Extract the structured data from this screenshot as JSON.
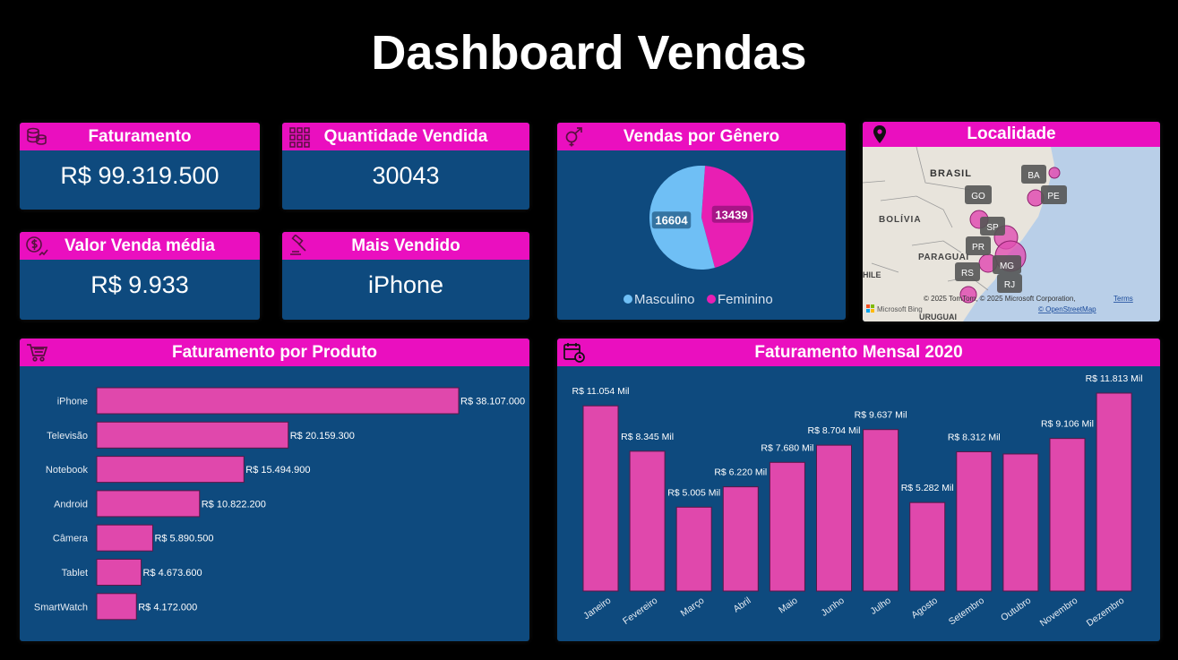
{
  "dashboard": {
    "title": "Dashboard Vendas"
  },
  "kpis": {
    "faturamento": {
      "label": "Faturamento",
      "value": "R$ 99.319.500"
    },
    "quantidade": {
      "label": "Quantidade Vendida",
      "value": "30043"
    },
    "ticket_medio": {
      "label": "Valor Venda média",
      "value": "R$ 9.933"
    },
    "mais_vendido": {
      "label": "Mais Vendido",
      "value": "iPhone"
    }
  },
  "colors": {
    "header": "#ea0fbf",
    "card": "#0e4a7e",
    "bar": "#e048ac",
    "masculino": "#6fbff5",
    "feminino": "#e81fb3"
  },
  "map": {
    "title": "Localidade",
    "country_labels": [
      "BRASIL",
      "BOLÍVIA",
      "PARAGUAI",
      "URUGUAI",
      "HILE"
    ],
    "state_labels": [
      "BA",
      "PE",
      "GO",
      "SP",
      "PR",
      "MG",
      "RS",
      "RJ"
    ],
    "attribution": "© 2025 TomTom, © 2025 Microsoft Corporation,",
    "terms": "Terms",
    "osm": "© OpenStreetMap",
    "bing": "Microsoft Bing"
  },
  "chart_data": [
    {
      "type": "pie",
      "title": "Vendas por Gênero",
      "labels": [
        "Masculino",
        "Feminino"
      ],
      "values": [
        16604,
        13439
      ],
      "colors": [
        "#6fbff5",
        "#e81fb3"
      ],
      "legend": "bottom"
    },
    {
      "type": "bar",
      "orientation": "horizontal",
      "title": "Faturamento por Produto",
      "categories": [
        "iPhone",
        "Televisão",
        "Notebook",
        "Android",
        "Câmera",
        "Tablet",
        "SmartWatch"
      ],
      "values": [
        38107000,
        20159300,
        15494900,
        10822200,
        5890500,
        4673600,
        4172000
      ],
      "data_labels": [
        "R$ 38.107.000",
        "R$ 20.159.300",
        "R$ 15.494.900",
        "R$ 10.822.200",
        "R$ 5.890.500",
        "R$ 4.673.600",
        "R$ 4.172.000"
      ]
    },
    {
      "type": "bar",
      "title": "Faturamento Mensal 2020",
      "categories": [
        "Janeiro",
        "Fevereiro",
        "Março",
        "Abril",
        "Maio",
        "Junho",
        "Julho",
        "Agosto",
        "Setembro",
        "Outubro",
        "Novembro",
        "Dezembro"
      ],
      "values": [
        11054,
        8345,
        5005,
        6220,
        7680,
        8704,
        9637,
        5282,
        8312,
        8180,
        9106,
        11813
      ],
      "value_unit": "mil",
      "data_labels": [
        "R$ 11.054 Mil",
        "R$ 8.345 Mil",
        "R$ 5.005 Mil",
        "R$ 6.220 Mil",
        "R$ 7.680 Mil",
        "R$ 8.704 Mil",
        "R$ 9.637 Mil",
        "R$ 5.282 Mil",
        "R$ 8.312 Mil",
        "",
        "R$ 9.106 Mil",
        "R$ 11.813 Mil"
      ]
    }
  ]
}
